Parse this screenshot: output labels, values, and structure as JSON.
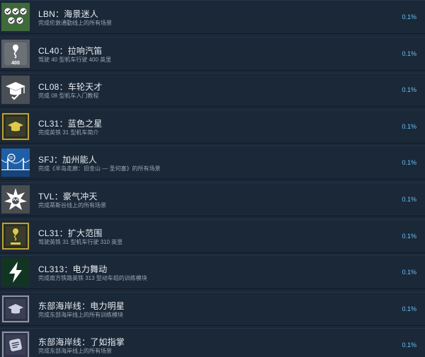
{
  "achievements": [
    {
      "title": "LBN：海景迷人",
      "desc": "完成伦敦通勤线上的所有场景",
      "percent": "0.1%",
      "icon": "checkmarks-icon",
      "icon_bg": "#3d6b3a"
    },
    {
      "title": "CL40：拉响汽笛",
      "desc": "驾驶 40 型机车行驶 400 英里",
      "percent": "0.1%",
      "icon": "route-400-icon",
      "icon_bg": "#5a5f66"
    },
    {
      "title": "CL08：车轮天才",
      "desc": "完成 08 型机车入门教程",
      "percent": "0.1%",
      "icon": "graduation-cap-icon",
      "icon_bg": "#4a4f56"
    },
    {
      "title": "CL31：蓝色之星",
      "desc": "完成英铁 31 型机车简介",
      "percent": "0.1%",
      "icon": "gold-cap-icon",
      "icon_bg": "#2a2d24"
    },
    {
      "title": "SFJ：加州能人",
      "desc": "完成《半岛走廊：旧金山 — 圣何塞》的所有场景",
      "percent": "0.1%",
      "icon": "bridge-icon",
      "icon_bg": "#1f5fa8"
    },
    {
      "title": "TVL：豪气冲天",
      "desc": "完成蒂斯谷线上的所有场景",
      "percent": "0.1%",
      "icon": "star-burst-icon",
      "icon_bg": "#4a4d52"
    },
    {
      "title": "CL31：扩大范围",
      "desc": "驾驶英铁 31 型机车行驶 310 英里",
      "percent": "0.1%",
      "icon": "gold-route-icon",
      "icon_bg": "#2a2d24"
    },
    {
      "title": "CL313：电力舞动",
      "desc": "完成南方铁路英铁 313 型动车组的训练模块",
      "percent": "0.1%",
      "icon": "lightning-icon",
      "icon_bg": "#16402a"
    },
    {
      "title": "东部海岸线：电力明星",
      "desc": "完成东部海岸线上的所有训练模块",
      "percent": "0.1%",
      "icon": "dark-cap-icon",
      "icon_bg": "#2c3040"
    },
    {
      "title": "东部海岸线：了如指掌",
      "desc": "完成东部海岸线上的所有场景",
      "percent": "0.1%",
      "icon": "card-icon",
      "icon_bg": "#30334a"
    }
  ]
}
